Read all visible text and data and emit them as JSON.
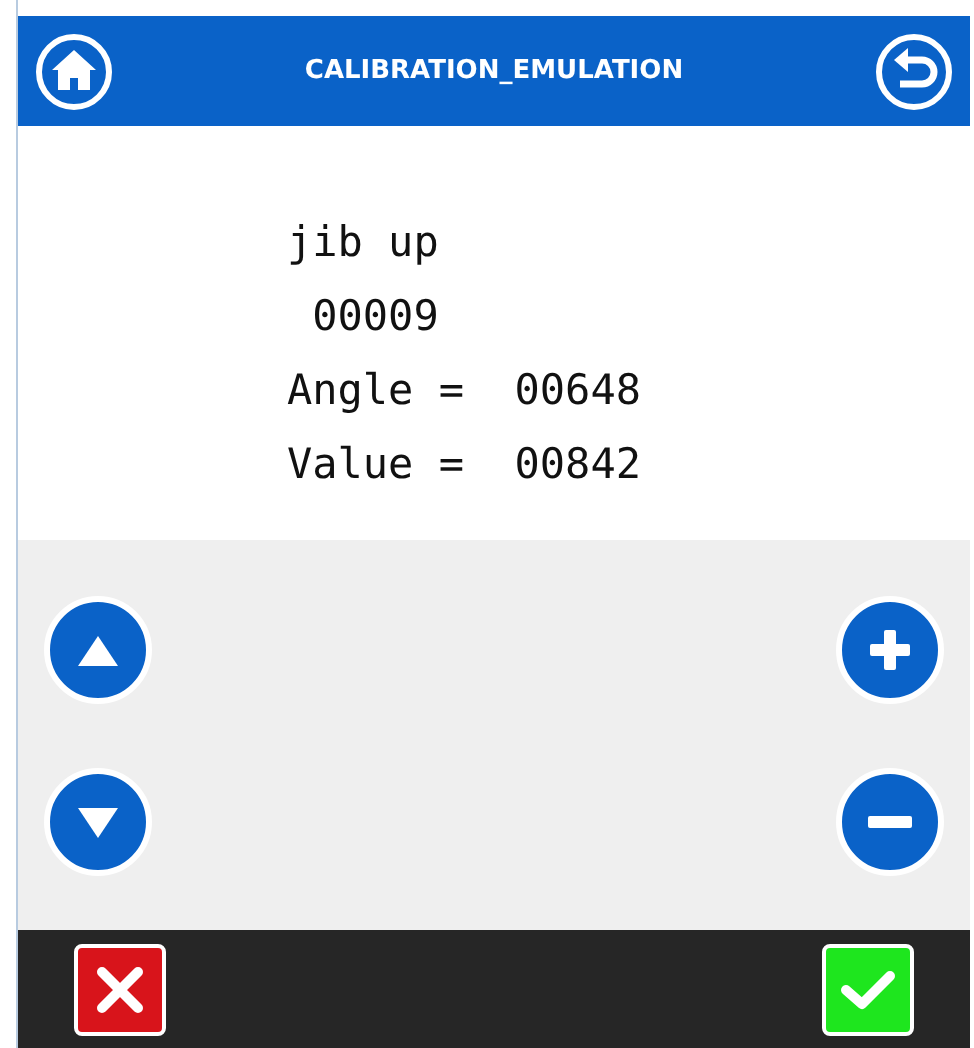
{
  "header": {
    "title": "CALIBRATION_EMULATION"
  },
  "readout": {
    "lines": [
      "jib up",
      " 00009",
      "Angle =  00648",
      "Value =  00842"
    ]
  },
  "controls": {
    "left": [
      {
        "kind": "up"
      },
      {
        "kind": "down"
      }
    ],
    "right": [
      {
        "kind": "plus"
      },
      {
        "kind": "minus"
      }
    ]
  },
  "footer": {
    "buttons": [
      {
        "kind": "cancel"
      },
      {
        "kind": "confirm"
      }
    ]
  }
}
